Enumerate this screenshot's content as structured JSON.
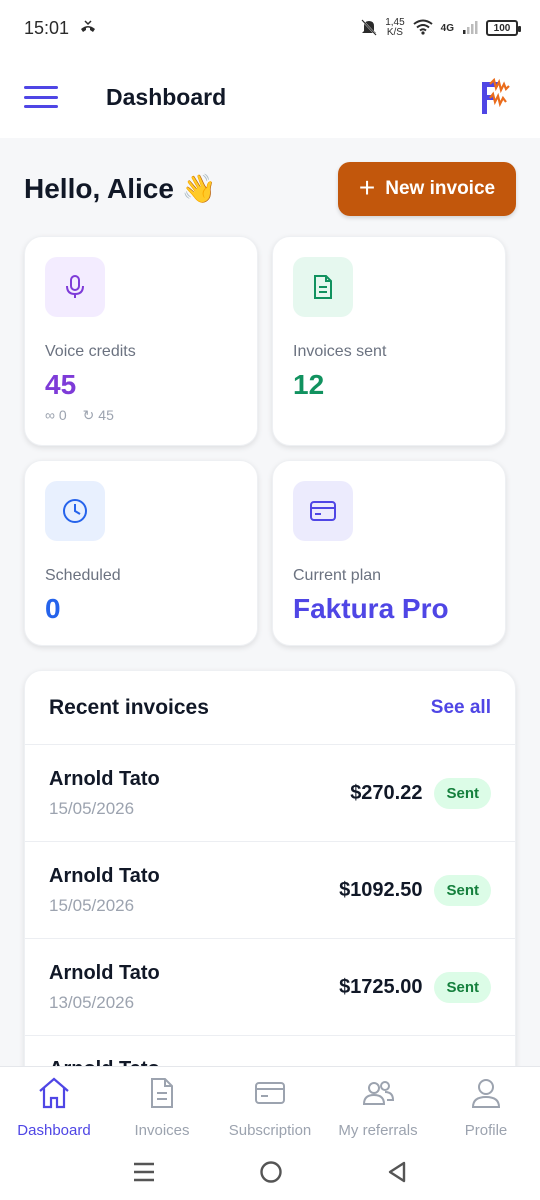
{
  "status": {
    "time": "15:01",
    "net_speed_value": "1,45",
    "net_speed_unit": "K/S",
    "network": "4G",
    "battery": "100"
  },
  "app_bar": {
    "title": "Dashboard"
  },
  "greeting": {
    "text": "Hello, Alice",
    "emoji": "👋"
  },
  "new_invoice": {
    "label": "New invoice"
  },
  "stats": {
    "voice_credits": {
      "label": "Voice credits",
      "value": "45",
      "sub_infinite": "0",
      "sub_refresh": "45",
      "color": "#7e3bd8"
    },
    "invoices_sent": {
      "label": "Invoices sent",
      "value": "12",
      "color": "#11925f"
    },
    "scheduled": {
      "label": "Scheduled",
      "value": "0",
      "color": "#2563eb"
    },
    "current_plan": {
      "label": "Current plan",
      "value": "Faktura Pro",
      "color": "#4f46e5"
    }
  },
  "recent": {
    "title": "Recent invoices",
    "see_all": "See all",
    "rows": [
      {
        "name": "Arnold Tato",
        "date": "15/05/2026",
        "amount": "$270.22",
        "status": "Sent"
      },
      {
        "name": "Arnold Tato",
        "date": "15/05/2026",
        "amount": "$1092.50",
        "status": "Sent"
      },
      {
        "name": "Arnold Tato",
        "date": "13/05/2026",
        "amount": "$1725.00",
        "status": "Sent"
      },
      {
        "name": "Arnold Tato",
        "date": "",
        "amount": "",
        "status": ""
      }
    ]
  },
  "bottom_nav": {
    "items": [
      {
        "label": "Dashboard",
        "icon": "home-icon",
        "active": true
      },
      {
        "label": "Invoices",
        "icon": "document-icon",
        "active": false
      },
      {
        "label": "Subscription",
        "icon": "credit-card-icon",
        "active": false
      },
      {
        "label": "My referrals",
        "icon": "users-icon",
        "active": false
      },
      {
        "label": "Profile",
        "icon": "user-icon",
        "active": false
      }
    ]
  },
  "colors": {
    "accent": "#4f46e5",
    "primary_button": "#c2570c",
    "sent_badge_bg": "#dcfce7",
    "sent_badge_text": "#15803d"
  }
}
